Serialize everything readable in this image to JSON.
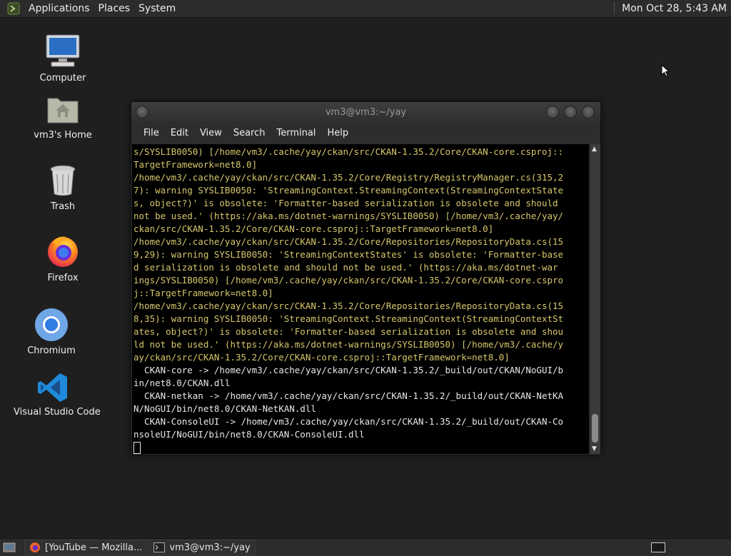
{
  "top_panel": {
    "menus": [
      "Applications",
      "Places",
      "System"
    ],
    "clock": "Mon Oct 28,  5:43 AM"
  },
  "desktop": {
    "icons": [
      {
        "label": "Computer",
        "icon": "computer-icon"
      },
      {
        "label": "vm3's Home",
        "icon": "home-folder-icon"
      },
      {
        "label": "Trash",
        "icon": "trash-icon"
      },
      {
        "label": "Firefox",
        "icon": "firefox-icon"
      },
      {
        "label": "Chromium",
        "icon": "chromium-icon"
      },
      {
        "label": "Visual Studio Code",
        "icon": "vscode-icon"
      }
    ]
  },
  "terminal": {
    "title": "vm3@vm3:~/yay",
    "menu": [
      "File",
      "Edit",
      "View",
      "Search",
      "Terminal",
      "Help"
    ],
    "lines": [
      {
        "t": "s/SYSLIB0050) [/home/vm3/.cache/yay/ckan/src/CKAN-1.35.2/Core/CKAN-core.csproj::",
        "c": "w"
      },
      {
        "t": "TargetFramework=net8.0]",
        "c": "w"
      },
      {
        "t": "/home/vm3/.cache/yay/ckan/src/CKAN-1.35.2/Core/Registry/RegistryManager.cs(315,2",
        "c": "w"
      },
      {
        "t": "7): warning SYSLIB0050: 'StreamingContext.StreamingContext(StreamingContextState",
        "c": "w"
      },
      {
        "t": "s, object?)' is obsolete: 'Formatter-based serialization is obsolete and should",
        "c": "w"
      },
      {
        "t": "not be used.' (https://aka.ms/dotnet-warnings/SYSLIB0050) [/home/vm3/.cache/yay/",
        "c": "w"
      },
      {
        "t": "ckan/src/CKAN-1.35.2/Core/CKAN-core.csproj::TargetFramework=net8.0]",
        "c": "w"
      },
      {
        "t": "/home/vm3/.cache/yay/ckan/src/CKAN-1.35.2/Core/Repositories/RepositoryData.cs(15",
        "c": "w"
      },
      {
        "t": "9,29): warning SYSLIB0050: 'StreamingContextStates' is obsolete: 'Formatter-base",
        "c": "w"
      },
      {
        "t": "d serialization is obsolete and should not be used.' (https://aka.ms/dotnet-war",
        "c": "w"
      },
      {
        "t": "ings/SYSLIB0050) [/home/vm3/.cache/yay/ckan/src/CKAN-1.35.2/Core/CKAN-core.cspro",
        "c": "w"
      },
      {
        "t": "j::TargetFramework=net8.0]",
        "c": "w"
      },
      {
        "t": "/home/vm3/.cache/yay/ckan/src/CKAN-1.35.2/Core/Repositories/RepositoryData.cs(15",
        "c": "w"
      },
      {
        "t": "8,35): warning SYSLIB0050: 'StreamingContext.StreamingContext(StreamingContextSt",
        "c": "w"
      },
      {
        "t": "ates, object?)' is obsolete: 'Formatter-based serialization is obsolete and shou",
        "c": "w"
      },
      {
        "t": "ld not be used.' (https://aka.ms/dotnet-warnings/SYSLIB0050) [/home/vm3/.cache/y",
        "c": "w"
      },
      {
        "t": "ay/ckan/src/CKAN-1.35.2/Core/CKAN-core.csproj::TargetFramework=net8.0]",
        "c": "w"
      },
      {
        "t": "  CKAN-core -> /home/vm3/.cache/yay/ckan/src/CKAN-1.35.2/_build/out/CKAN/NoGUI/b",
        "c": "n"
      },
      {
        "t": "in/net8.0/CKAN.dll",
        "c": "n"
      },
      {
        "t": "  CKAN-netkan -> /home/vm3/.cache/yay/ckan/src/CKAN-1.35.2/_build/out/CKAN-NetKA",
        "c": "n"
      },
      {
        "t": "N/NoGUI/bin/net8.0/CKAN-NetKAN.dll",
        "c": "n"
      },
      {
        "t": "  CKAN-ConsoleUI -> /home/vm3/.cache/yay/ckan/src/CKAN-1.35.2/_build/out/CKAN-Co",
        "c": "n"
      },
      {
        "t": "nsoleUI/NoGUI/bin/net8.0/CKAN-ConsoleUI.dll",
        "c": "n"
      }
    ]
  },
  "taskbar": {
    "items": [
      {
        "label": "[YouTube — Mozilla...",
        "icon": "firefox-icon"
      },
      {
        "label": "vm3@vm3:~/yay",
        "icon": "terminal-icon"
      }
    ]
  }
}
